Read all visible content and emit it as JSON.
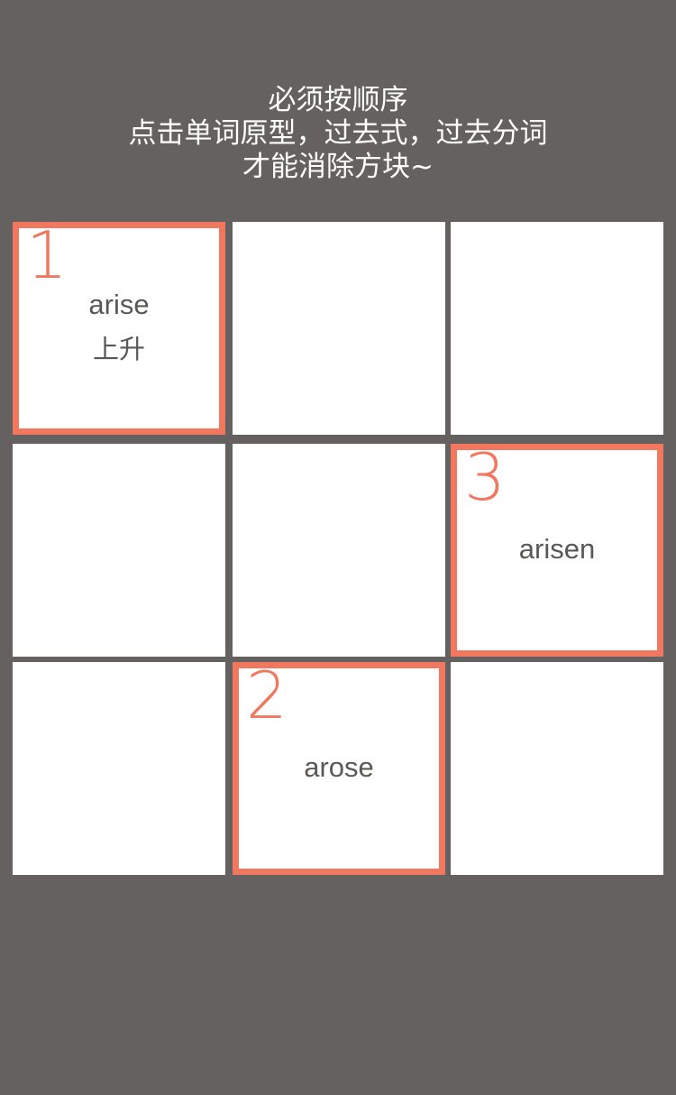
{
  "instructions": {
    "line1": "必须按顺序",
    "line2": "点击单词原型，过去式，过去分词",
    "line3": "才能消除方块~"
  },
  "board": {
    "tiles": [
      {
        "number": "1",
        "word": "arise",
        "meaning": "上升",
        "selected": true
      },
      {
        "number": "",
        "word": "",
        "meaning": "",
        "selected": false
      },
      {
        "number": "",
        "word": "",
        "meaning": "",
        "selected": false
      },
      {
        "number": "",
        "word": "",
        "meaning": "",
        "selected": false
      },
      {
        "number": "",
        "word": "",
        "meaning": "",
        "selected": false
      },
      {
        "number": "3",
        "word": "arisen",
        "meaning": "",
        "selected": true
      },
      {
        "number": "",
        "word": "",
        "meaning": "",
        "selected": false
      },
      {
        "number": "2",
        "word": "arose",
        "meaning": "",
        "selected": true
      },
      {
        "number": "",
        "word": "",
        "meaning": "",
        "selected": false
      }
    ]
  },
  "colors": {
    "background": "#656160",
    "tile": "#ffffff",
    "accent": "#f2775f",
    "text": "#5a5857"
  }
}
